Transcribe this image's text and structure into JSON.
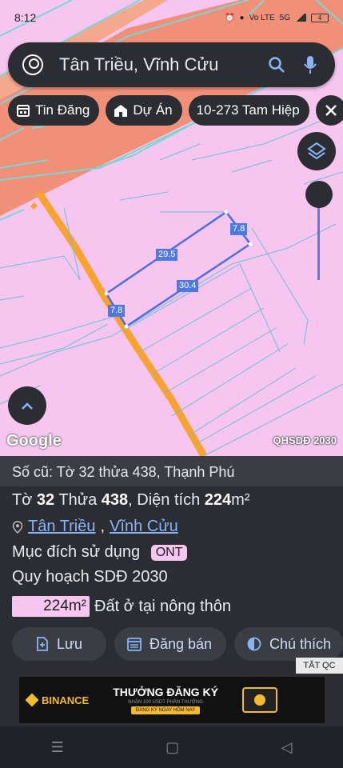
{
  "status_bar": {
    "time": "8:12",
    "network": "Vo LTE",
    "signal": "5G",
    "battery": "4"
  },
  "search": {
    "query": "Tân Triều, Vĩnh Cửu"
  },
  "chips": [
    {
      "label": "Tin Đăng"
    },
    {
      "label": "Dự Án"
    },
    {
      "label": "10-273 Tam Hiệp"
    }
  ],
  "map": {
    "dimensions": [
      "7.8",
      "29.5",
      "30.4",
      "7.8"
    ],
    "attribution": "Google",
    "layer_label": "QHSDĐ 2030"
  },
  "parcel": {
    "old_ref": "Số cũ: Tờ 32 thửa 438, Thạnh Phú",
    "sheet_word": "Tờ",
    "sheet": "32",
    "plot_word": "Thửa",
    "plot": "438",
    "area_word": ", Diện tích",
    "area": "224",
    "area_unit": "m²",
    "commune": "Tân Triều",
    "district": "Vĩnh Cửu",
    "purpose_label": "Mục đích sử dụng",
    "purpose_code": "ONT",
    "plan_label": "Quy hoạch SDĐ 2030",
    "plan_area": "224m²",
    "plan_type": "Đất ở tại nông thôn"
  },
  "actions": [
    {
      "label": "Lưu"
    },
    {
      "label": "Đăng bán"
    },
    {
      "label": "Chú thích"
    }
  ],
  "ad": {
    "close_label": "TẮT QC",
    "brand": "BINANCE",
    "headline": "THƯỞNG ĐĂNG KÝ",
    "sub": "NHẬN 100 USDT PHẦN THƯỞNG",
    "cta": "ĐĂNG KÝ NGAY HÔM NAY"
  }
}
